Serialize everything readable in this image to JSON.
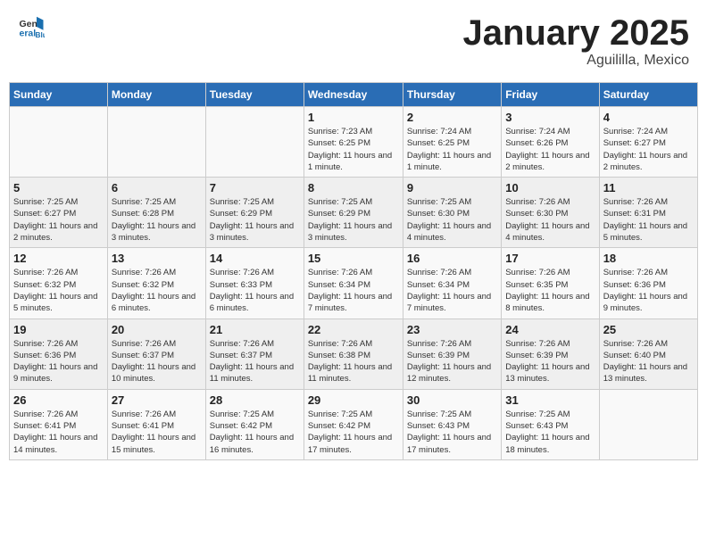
{
  "header": {
    "logo_general": "General",
    "logo_blue": "Blue",
    "month_year": "January 2025",
    "location": "Aguililla, Mexico"
  },
  "weekdays": [
    "Sunday",
    "Monday",
    "Tuesday",
    "Wednesday",
    "Thursday",
    "Friday",
    "Saturday"
  ],
  "weeks": [
    [
      {
        "day": "",
        "sunrise": "",
        "sunset": "",
        "daylight": ""
      },
      {
        "day": "",
        "sunrise": "",
        "sunset": "",
        "daylight": ""
      },
      {
        "day": "",
        "sunrise": "",
        "sunset": "",
        "daylight": ""
      },
      {
        "day": "1",
        "sunrise": "Sunrise: 7:23 AM",
        "sunset": "Sunset: 6:25 PM",
        "daylight": "Daylight: 11 hours and 1 minute."
      },
      {
        "day": "2",
        "sunrise": "Sunrise: 7:24 AM",
        "sunset": "Sunset: 6:25 PM",
        "daylight": "Daylight: 11 hours and 1 minute."
      },
      {
        "day": "3",
        "sunrise": "Sunrise: 7:24 AM",
        "sunset": "Sunset: 6:26 PM",
        "daylight": "Daylight: 11 hours and 2 minutes."
      },
      {
        "day": "4",
        "sunrise": "Sunrise: 7:24 AM",
        "sunset": "Sunset: 6:27 PM",
        "daylight": "Daylight: 11 hours and 2 minutes."
      }
    ],
    [
      {
        "day": "5",
        "sunrise": "Sunrise: 7:25 AM",
        "sunset": "Sunset: 6:27 PM",
        "daylight": "Daylight: 11 hours and 2 minutes."
      },
      {
        "day": "6",
        "sunrise": "Sunrise: 7:25 AM",
        "sunset": "Sunset: 6:28 PM",
        "daylight": "Daylight: 11 hours and 3 minutes."
      },
      {
        "day": "7",
        "sunrise": "Sunrise: 7:25 AM",
        "sunset": "Sunset: 6:29 PM",
        "daylight": "Daylight: 11 hours and 3 minutes."
      },
      {
        "day": "8",
        "sunrise": "Sunrise: 7:25 AM",
        "sunset": "Sunset: 6:29 PM",
        "daylight": "Daylight: 11 hours and 3 minutes."
      },
      {
        "day": "9",
        "sunrise": "Sunrise: 7:25 AM",
        "sunset": "Sunset: 6:30 PM",
        "daylight": "Daylight: 11 hours and 4 minutes."
      },
      {
        "day": "10",
        "sunrise": "Sunrise: 7:26 AM",
        "sunset": "Sunset: 6:30 PM",
        "daylight": "Daylight: 11 hours and 4 minutes."
      },
      {
        "day": "11",
        "sunrise": "Sunrise: 7:26 AM",
        "sunset": "Sunset: 6:31 PM",
        "daylight": "Daylight: 11 hours and 5 minutes."
      }
    ],
    [
      {
        "day": "12",
        "sunrise": "Sunrise: 7:26 AM",
        "sunset": "Sunset: 6:32 PM",
        "daylight": "Daylight: 11 hours and 5 minutes."
      },
      {
        "day": "13",
        "sunrise": "Sunrise: 7:26 AM",
        "sunset": "Sunset: 6:32 PM",
        "daylight": "Daylight: 11 hours and 6 minutes."
      },
      {
        "day": "14",
        "sunrise": "Sunrise: 7:26 AM",
        "sunset": "Sunset: 6:33 PM",
        "daylight": "Daylight: 11 hours and 6 minutes."
      },
      {
        "day": "15",
        "sunrise": "Sunrise: 7:26 AM",
        "sunset": "Sunset: 6:34 PM",
        "daylight": "Daylight: 11 hours and 7 minutes."
      },
      {
        "day": "16",
        "sunrise": "Sunrise: 7:26 AM",
        "sunset": "Sunset: 6:34 PM",
        "daylight": "Daylight: 11 hours and 7 minutes."
      },
      {
        "day": "17",
        "sunrise": "Sunrise: 7:26 AM",
        "sunset": "Sunset: 6:35 PM",
        "daylight": "Daylight: 11 hours and 8 minutes."
      },
      {
        "day": "18",
        "sunrise": "Sunrise: 7:26 AM",
        "sunset": "Sunset: 6:36 PM",
        "daylight": "Daylight: 11 hours and 9 minutes."
      }
    ],
    [
      {
        "day": "19",
        "sunrise": "Sunrise: 7:26 AM",
        "sunset": "Sunset: 6:36 PM",
        "daylight": "Daylight: 11 hours and 9 minutes."
      },
      {
        "day": "20",
        "sunrise": "Sunrise: 7:26 AM",
        "sunset": "Sunset: 6:37 PM",
        "daylight": "Daylight: 11 hours and 10 minutes."
      },
      {
        "day": "21",
        "sunrise": "Sunrise: 7:26 AM",
        "sunset": "Sunset: 6:37 PM",
        "daylight": "Daylight: 11 hours and 11 minutes."
      },
      {
        "day": "22",
        "sunrise": "Sunrise: 7:26 AM",
        "sunset": "Sunset: 6:38 PM",
        "daylight": "Daylight: 11 hours and 11 minutes."
      },
      {
        "day": "23",
        "sunrise": "Sunrise: 7:26 AM",
        "sunset": "Sunset: 6:39 PM",
        "daylight": "Daylight: 11 hours and 12 minutes."
      },
      {
        "day": "24",
        "sunrise": "Sunrise: 7:26 AM",
        "sunset": "Sunset: 6:39 PM",
        "daylight": "Daylight: 11 hours and 13 minutes."
      },
      {
        "day": "25",
        "sunrise": "Sunrise: 7:26 AM",
        "sunset": "Sunset: 6:40 PM",
        "daylight": "Daylight: 11 hours and 13 minutes."
      }
    ],
    [
      {
        "day": "26",
        "sunrise": "Sunrise: 7:26 AM",
        "sunset": "Sunset: 6:41 PM",
        "daylight": "Daylight: 11 hours and 14 minutes."
      },
      {
        "day": "27",
        "sunrise": "Sunrise: 7:26 AM",
        "sunset": "Sunset: 6:41 PM",
        "daylight": "Daylight: 11 hours and 15 minutes."
      },
      {
        "day": "28",
        "sunrise": "Sunrise: 7:25 AM",
        "sunset": "Sunset: 6:42 PM",
        "daylight": "Daylight: 11 hours and 16 minutes."
      },
      {
        "day": "29",
        "sunrise": "Sunrise: 7:25 AM",
        "sunset": "Sunset: 6:42 PM",
        "daylight": "Daylight: 11 hours and 17 minutes."
      },
      {
        "day": "30",
        "sunrise": "Sunrise: 7:25 AM",
        "sunset": "Sunset: 6:43 PM",
        "daylight": "Daylight: 11 hours and 17 minutes."
      },
      {
        "day": "31",
        "sunrise": "Sunrise: 7:25 AM",
        "sunset": "Sunset: 6:43 PM",
        "daylight": "Daylight: 11 hours and 18 minutes."
      },
      {
        "day": "",
        "sunrise": "",
        "sunset": "",
        "daylight": ""
      }
    ]
  ]
}
